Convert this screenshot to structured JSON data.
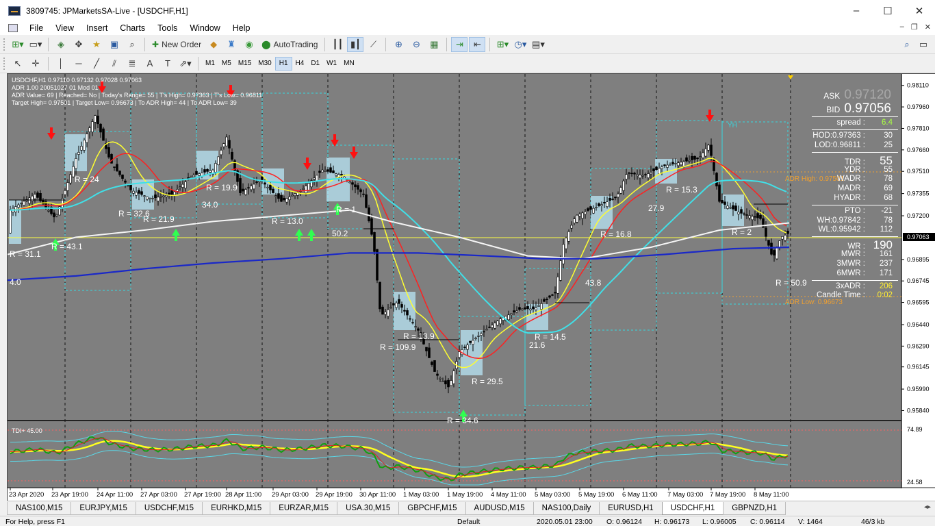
{
  "window": {
    "title": "3809745: JPMarketsSA-Live - [USDCHF,H1]",
    "min": "–",
    "max": "☐",
    "close": "✕"
  },
  "menu": [
    "File",
    "View",
    "Insert",
    "Charts",
    "Tools",
    "Window",
    "Help"
  ],
  "toolbar": {
    "new_order": "New Order",
    "autotrading": "AutoTrading"
  },
  "timeframes": [
    "M1",
    "M5",
    "M15",
    "M30",
    "H1",
    "H4",
    "D1",
    "W1",
    "MN"
  ],
  "timeframe_active": "H1",
  "chart": {
    "ohlc": "USDCHF,H1  0.97110 0.97132 0.97028 0.97063",
    "indicator_lines": [
      "ADR 1.00 20051027 01 Mod 01",
      "ADR Value= 69  | Reached= No  | Today's Range= 55  | T's High= 0.97363  | T's Low= 0.96811",
      "Target High= 0.97501  | Target Low= 0.96673  | To ADR High= 44  | To ADR Low= 39"
    ],
    "price_levels": [
      "0.98110",
      "0.97960",
      "0.97810",
      "0.97660",
      "0.97510",
      "0.97355",
      "0.97200",
      "0.97063",
      "0.96895",
      "0.96745",
      "0.96595",
      "0.96440",
      "0.96290",
      "0.96145",
      "0.95990",
      "0.95840"
    ],
    "current_price": "0.97063",
    "tdi_label": "TDI+ 45.00",
    "tdi_levels": [
      "74.89",
      "24.58"
    ],
    "time_labels": [
      "23 Apr 2020",
      "23 Apr 19:00",
      "24 Apr 11:00",
      "27 Apr 03:00",
      "27 Apr 19:00",
      "28 Apr 11:00",
      "29 Apr 03:00",
      "29 Apr 19:00",
      "30 Apr 11:00",
      "1 May 03:00",
      "1 May 19:00",
      "4 May 11:00",
      "5 May 03:00",
      "5 May 19:00",
      "6 May 11:00",
      "7 May 03:00",
      "7 May 19:00",
      "8 May 11:00"
    ],
    "range_labels": [
      "R = 31.1",
      "R = 43.1",
      "R = 24",
      "R = 32.6",
      "R = 21.9",
      "34.0",
      "R = 19.9",
      "R = 13.0",
      "50.2",
      "R = 1",
      "R = 109.9",
      "R = 13.9",
      "R = 34.6",
      "R = 29.5",
      "R = 14.5",
      "21.6",
      "43.8",
      "R = 16.8",
      "27.9",
      "R = 15.3",
      "R = 2",
      "R = 50.9",
      "4.0"
    ],
    "adr_high": "ADR High: 0.97501",
    "adr_low": "ADR Low: 0.96673",
    "yh": "YH"
  },
  "panel": {
    "ask_label": "ASK",
    "ask": "0.97120",
    "bid_label": "BID",
    "bid": "0.97056",
    "spread_label": "spread :",
    "spread": "6.4",
    "rows": [
      {
        "k": "HOD:0.97363 :",
        "v": "30"
      },
      {
        "k": "LOD:0.96811 :",
        "v": "25"
      },
      {
        "k": "TDR :",
        "v": "55",
        "big": true
      },
      {
        "k": "YDR :",
        "v": "55"
      },
      {
        "k": "WADR :",
        "v": "78"
      },
      {
        "k": "MADR :",
        "v": "69"
      },
      {
        "k": "HYADR :",
        "v": "68"
      },
      {
        "k": "PTO :",
        "v": "-21"
      },
      {
        "k": "WH:0.97842 :",
        "v": "78"
      },
      {
        "k": "WL:0.95942 :",
        "v": "112"
      },
      {
        "k": "WR :",
        "v": "190",
        "big": true
      },
      {
        "k": "MWR :",
        "v": "161"
      },
      {
        "k": "3MWR :",
        "v": "237"
      },
      {
        "k": "6MWR :",
        "v": "171"
      },
      {
        "k": "3xADR :",
        "v": "206",
        "yellow": true
      },
      {
        "k": "Candle Time :",
        "v": "0:02",
        "yellow": true
      }
    ]
  },
  "tabs": [
    "NAS100,M15",
    "EURJPY,M15",
    "USDCHF,M15",
    "EURHKD,M15",
    "EURZAR,M15",
    "USA.30,M15",
    "GBPCHF,M15",
    "AUDUSD,M15",
    "NAS100,Daily",
    "EURUSD,H1",
    "USDCHF,H1",
    "GBPNZD,H1"
  ],
  "tab_active": "USDCHF,H1",
  "status": {
    "help": "For Help, press F1",
    "profile": "Default",
    "time": "2020.05.01 23:00",
    "open": "O: 0.96124",
    "high": "H: 0.96173",
    "low": "L: 0.96005",
    "close": "C: 0.96114",
    "volume": "V: 1464",
    "conn": "46/3 kb"
  }
}
